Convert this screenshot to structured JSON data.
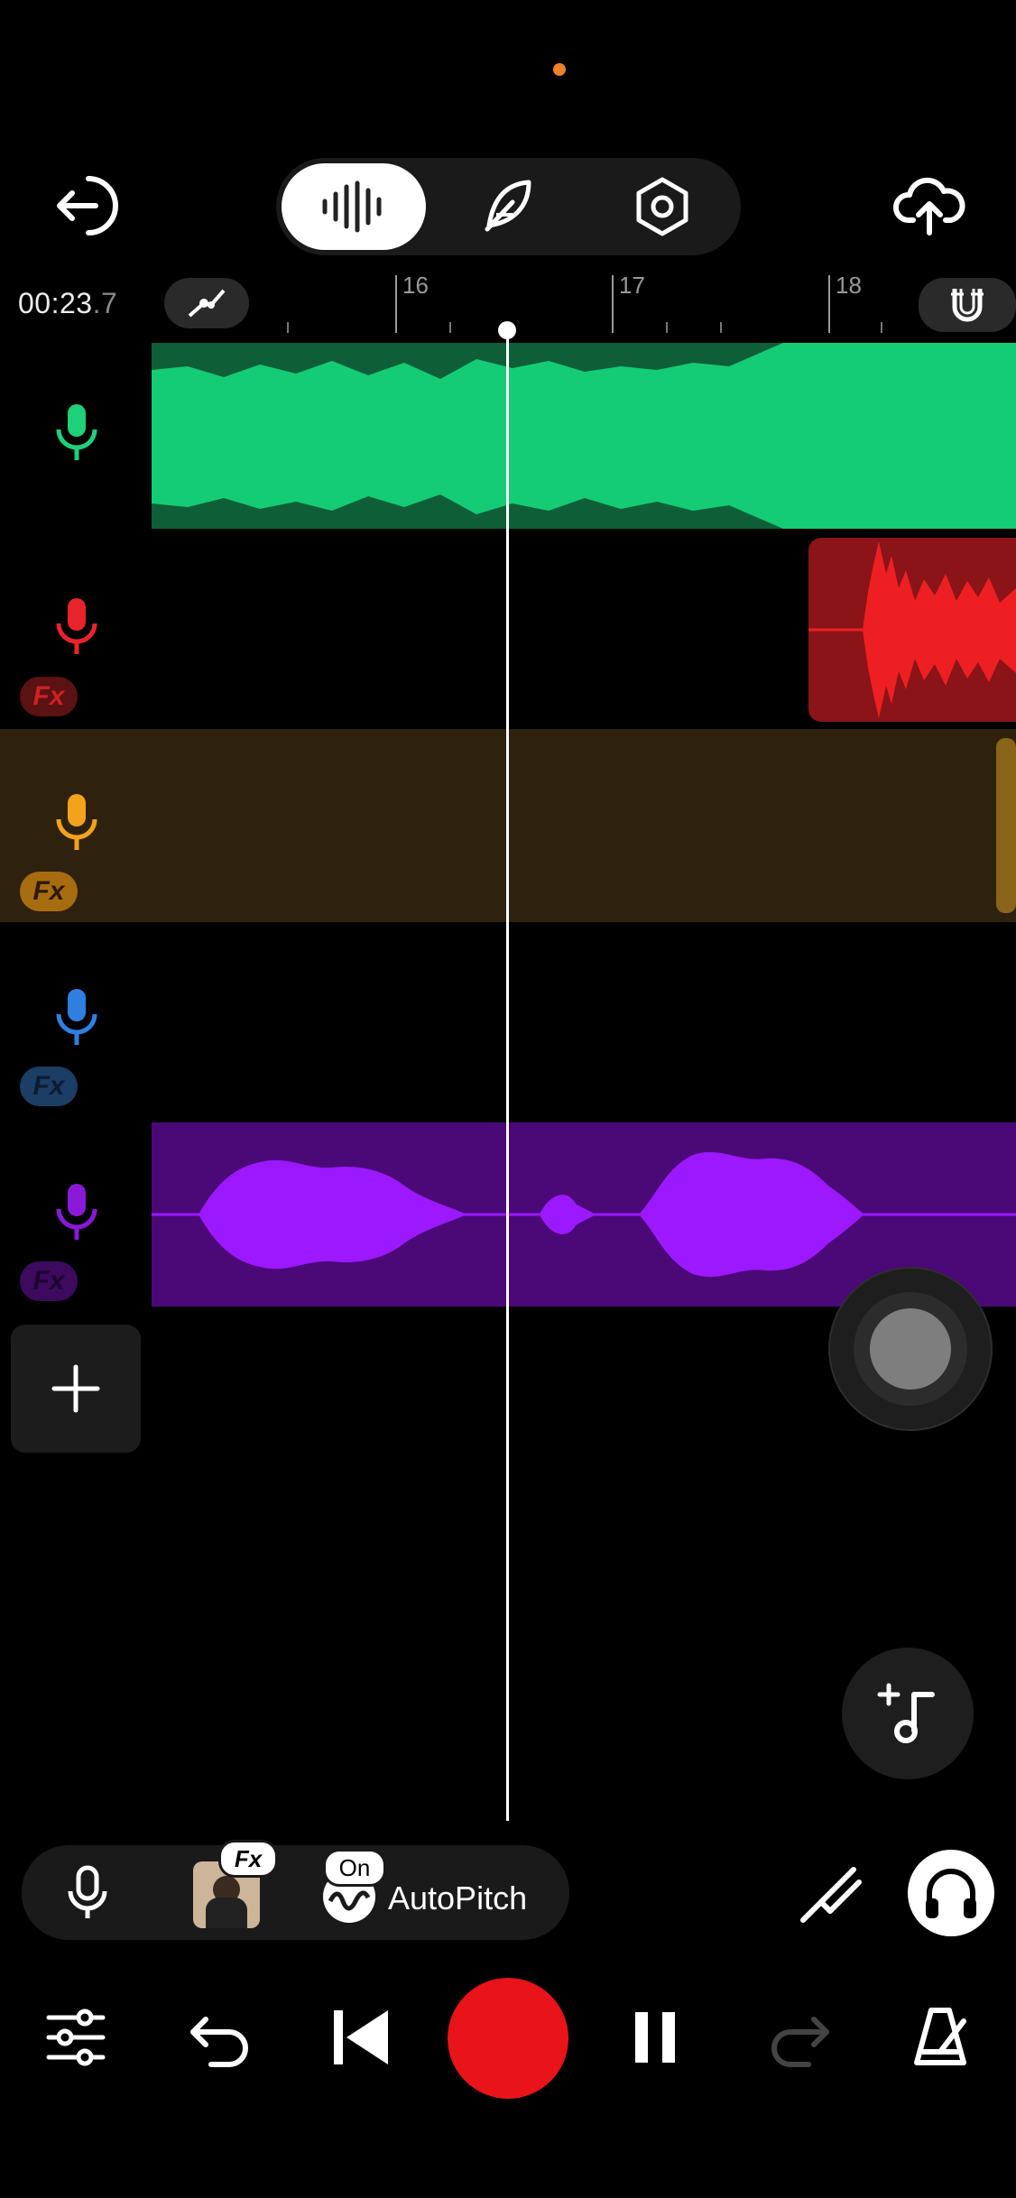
{
  "status": {
    "indicator_color": "#f0802a"
  },
  "header": {
    "back_icon": "exit-icon",
    "modes": [
      {
        "name": "waveform-icon",
        "active": true
      },
      {
        "name": "feather-icon",
        "active": false
      },
      {
        "name": "settings-hex-icon",
        "active": false
      }
    ],
    "upload_icon": "cloud-upload-icon"
  },
  "timeline": {
    "time_main": "00:23",
    "time_fraction": ".7",
    "markers": [
      "16",
      "17",
      "18"
    ],
    "automation_icon": "automation-curve-icon",
    "snap_icon": "magnet-icon"
  },
  "tracks": [
    {
      "color": "#1fd07a",
      "fx": false,
      "clip_color": "#14cc75"
    },
    {
      "color": "#e8242a",
      "fx": true,
      "fx_label": "Fx",
      "clip_color": "#ee1f22"
    },
    {
      "color": "#f2a31b",
      "fx": true,
      "fx_label": "Fx",
      "clip_color": "#2e220e"
    },
    {
      "color": "#2f7fe0",
      "fx": true,
      "fx_label": "Fx"
    },
    {
      "color": "#8a18d8",
      "fx": true,
      "fx_label": "Fx",
      "clip_color": "#9b18ff"
    }
  ],
  "add_track_icon": "plus-icon",
  "add_music_icon": "add-music-note-icon",
  "bottom_bar": {
    "mic_icon": "microphone-icon",
    "fx_preset_badge": "Fx",
    "autopitch_badge": "On",
    "autopitch_label": "AutoPitch",
    "tuning_icon": "tuning-fork-icon",
    "monitor_icon": "headphones-icon"
  },
  "transport": {
    "mixer_icon": "sliders-icon",
    "undo_icon": "undo-icon",
    "rewind_icon": "skip-back-icon",
    "record_color": "#e8141a",
    "pause_icon": "pause-icon",
    "redo_icon": "redo-icon",
    "metronome_icon": "metronome-icon"
  }
}
